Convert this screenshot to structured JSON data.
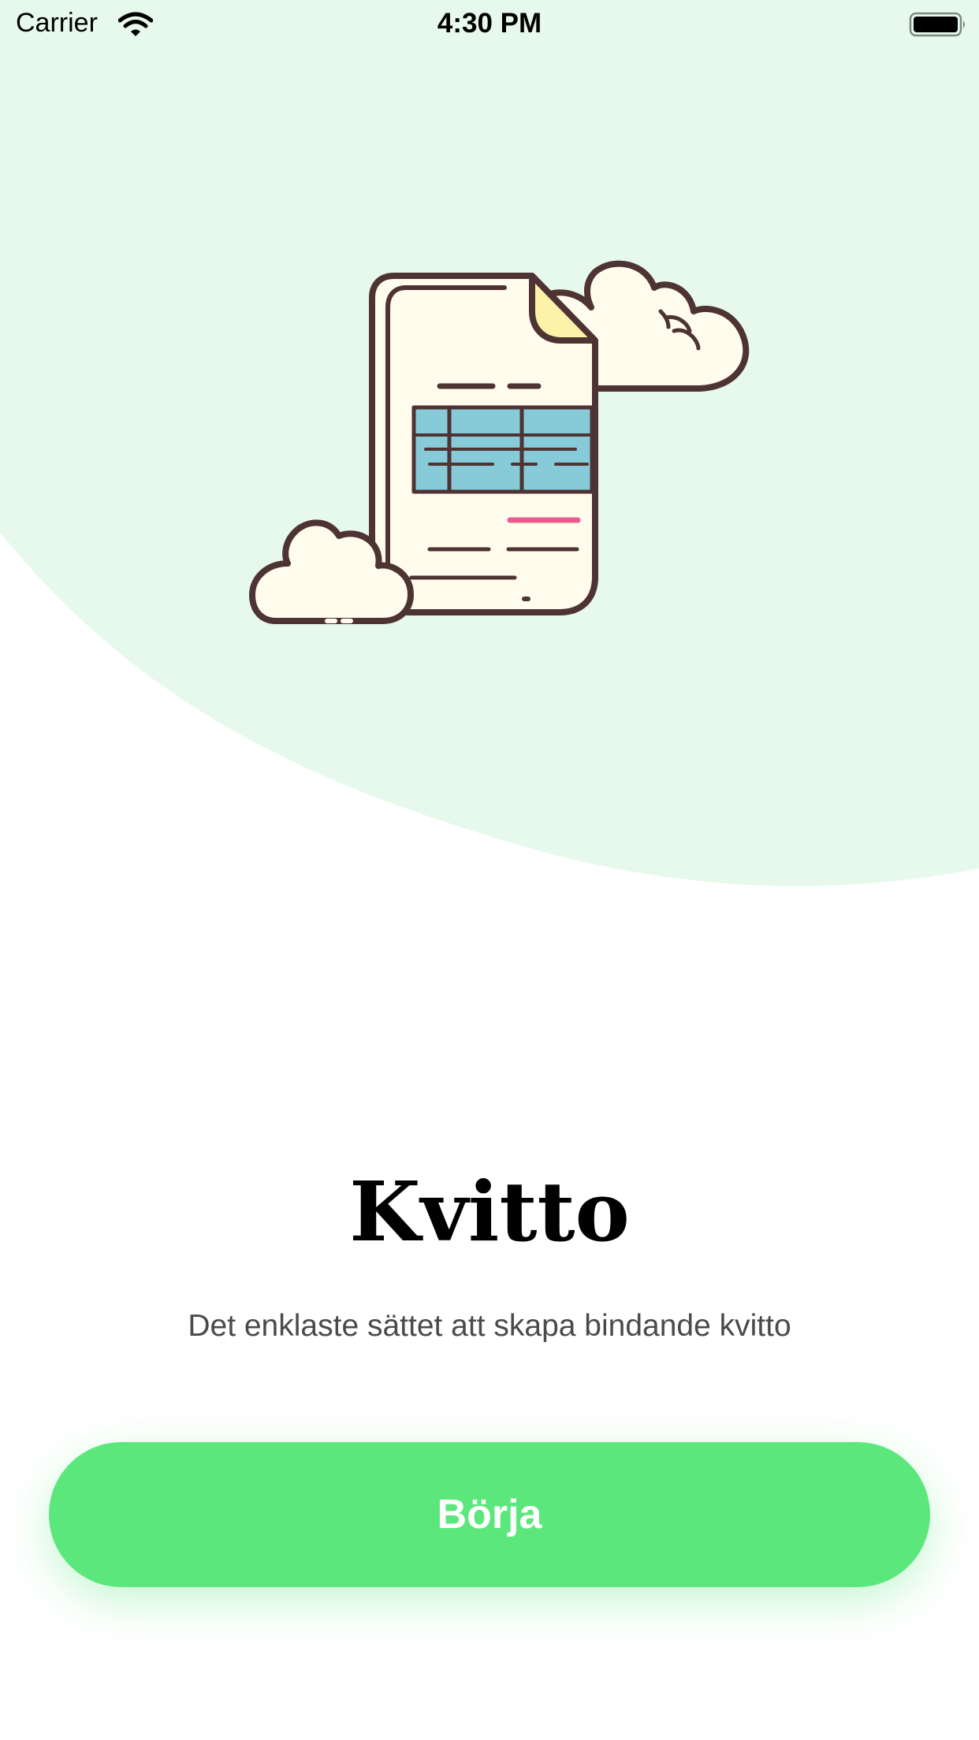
{
  "status_bar": {
    "carrier": "Carrier",
    "time": "4:30 PM",
    "wifi_icon": "wifi-icon",
    "battery_icon": "battery-icon"
  },
  "illustration": {
    "icon": "receipt-document-with-clouds-illustration"
  },
  "main": {
    "title": "Kvitto",
    "subtitle": "Det enklaste sättet att skapa bindande kvitto",
    "start_button_label": "Börja"
  },
  "colors": {
    "background_blob": "#e7f9ec",
    "button": "#5ce77d",
    "subtitle_text": "#4a4a4a",
    "outline": "#4e3333",
    "paper": "#fffcee",
    "paper_fold": "#fdf3a8",
    "table": "#87cad8",
    "accent_line": "#ea5a8e"
  }
}
